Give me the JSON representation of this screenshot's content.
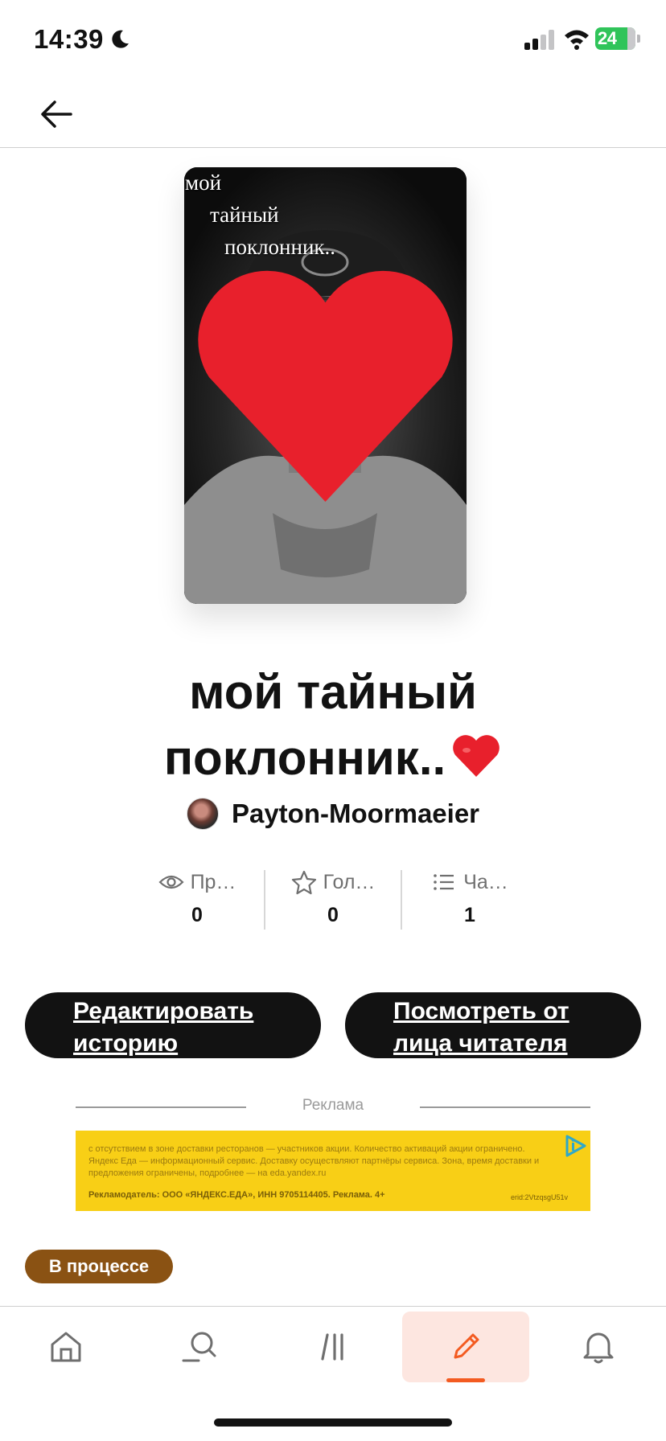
{
  "status_bar": {
    "time": "14:39",
    "battery": "24"
  },
  "cover": {
    "line1": "мой",
    "line2": "тайный",
    "line3": "поклонник.."
  },
  "story": {
    "title": "мой тайный поклонник..",
    "author": "Payton-Moormaeier"
  },
  "stats": [
    {
      "label": "Пр…",
      "value": "0",
      "icon": "eye-icon"
    },
    {
      "label": "Гол…",
      "value": "0",
      "icon": "star-icon"
    },
    {
      "label": "Ча…",
      "value": "1",
      "icon": "list-icon"
    }
  ],
  "buttons": {
    "edit": "Редактировать историю",
    "read": "Посмотреть от лица читателя"
  },
  "ad": {
    "label": "Реклама",
    "text": "с отсутствием в зоне доставки ресторанов — участников акции. Количество активаций акции ограничено. Яндекс Еда — информационный сервис. Доставку осуществляют партнёры сервиса. Зона, время доставки и предложения ограничены, подробнее — на eda.yandex.ru",
    "advertiser": "Рекламодатель: ООО «ЯНДЕКС.ЕДА», ИНН 9705114405. Реклама. 4+",
    "erid": "erid:2VtzqsgU51v"
  },
  "status_pill": "В процессе",
  "colors": {
    "accent": "#f35b21",
    "pill": "#8a5213",
    "ad_bg": "#f8cf16",
    "button_bg": "#121212"
  },
  "bottom_nav": [
    "home-icon",
    "search-icon",
    "library-icon",
    "write-icon",
    "bell-icon"
  ]
}
